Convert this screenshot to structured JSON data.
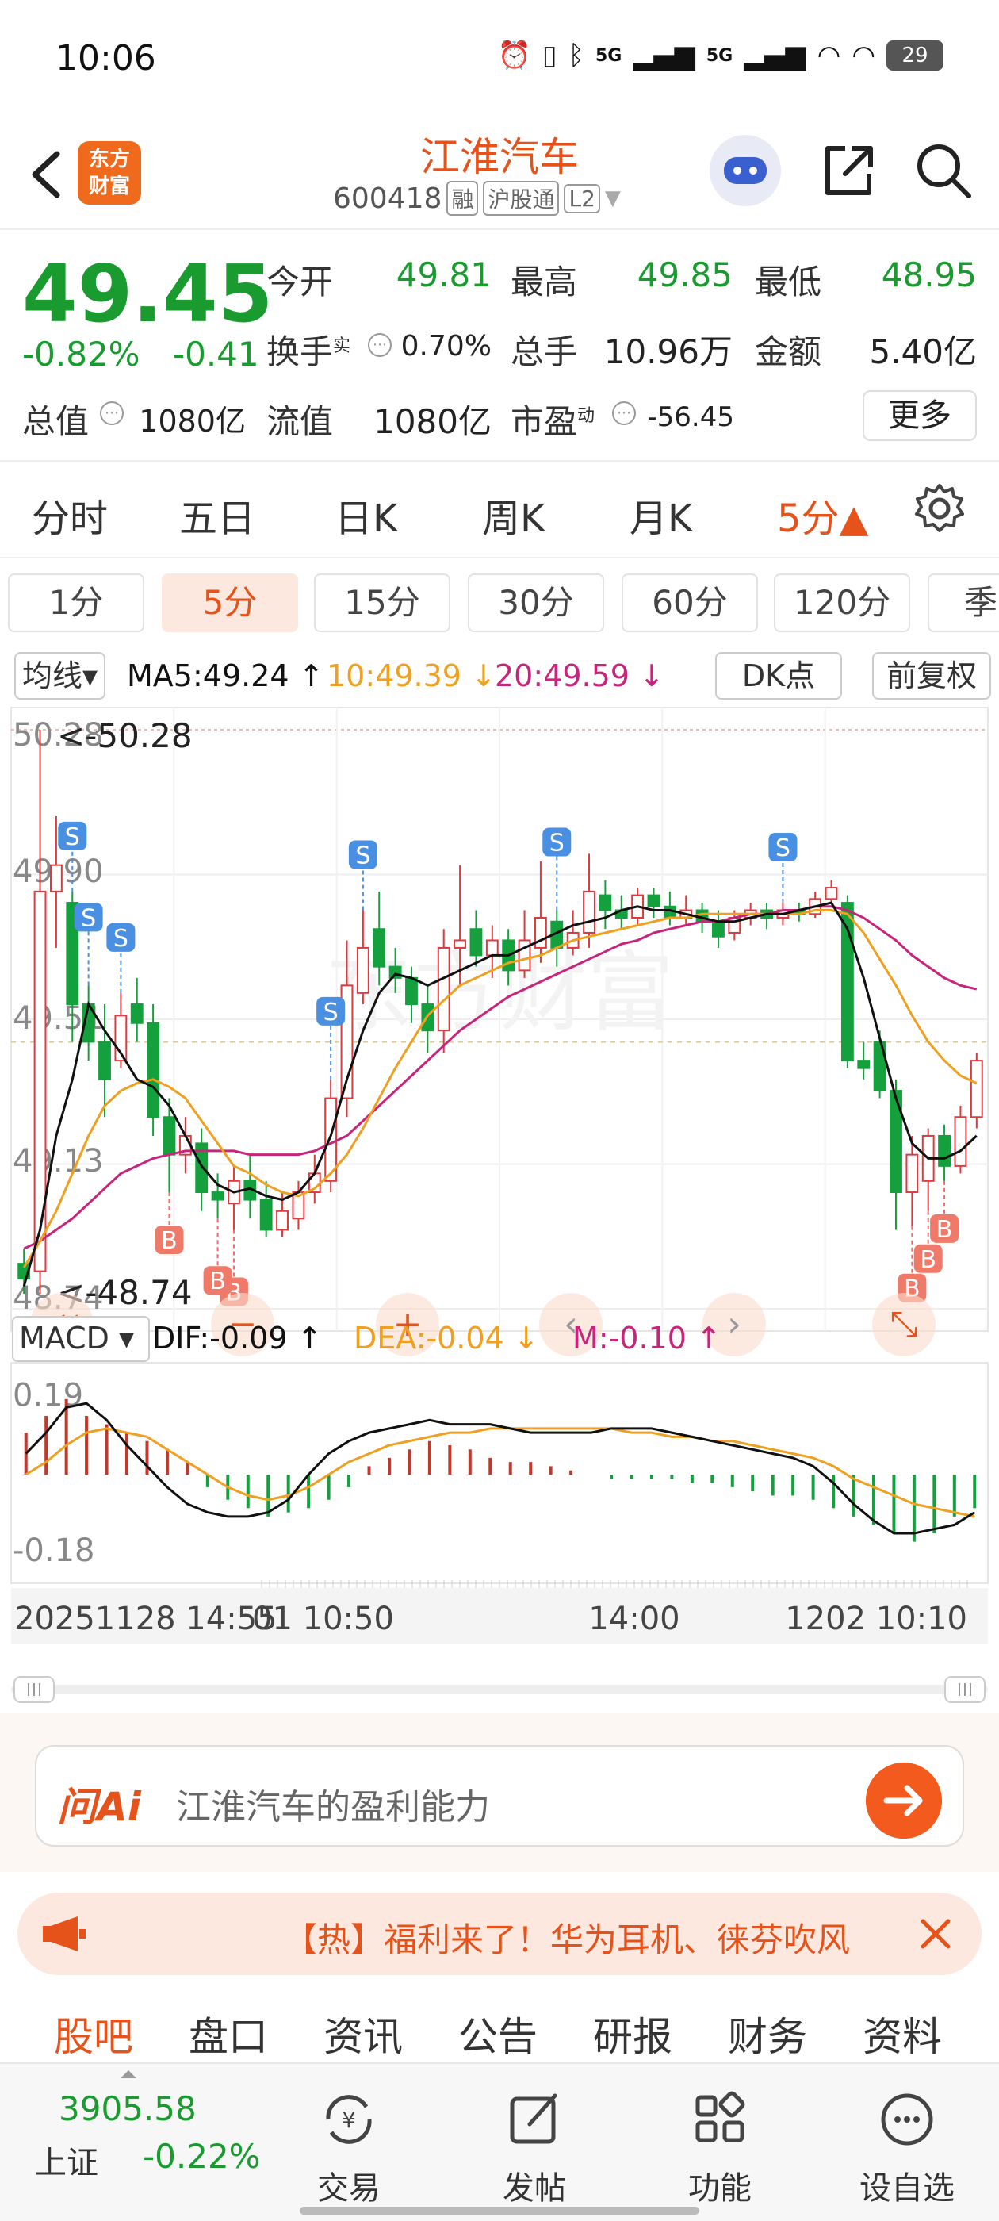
{
  "status": {
    "time": "10:06",
    "signal_label": "5G",
    "battery": "29"
  },
  "header": {
    "stock_name": "江淮汽车",
    "stock_code": "600418",
    "tags": [
      "融",
      "沪股通",
      "L2"
    ],
    "logo_text_line1": "东方",
    "logo_text_line2": "财富"
  },
  "quote": {
    "price": "49.45",
    "change_pct": "-0.82%",
    "change": "-0.41",
    "open_label": "今开",
    "open": "49.81",
    "high_label": "最高",
    "high": "49.85",
    "low_label": "最低",
    "low": "48.95",
    "turnover_label": "换手",
    "turnover_sup": "实",
    "turnover": "0.70%",
    "volume_label": "总手",
    "volume": "10.96万",
    "amount_label": "金额",
    "amount": "5.40亿",
    "mcap_label": "总值",
    "mcap": "1080亿",
    "float_label": "流值",
    "float": "1080亿",
    "pe_label": "市盈",
    "pe_sup": "动",
    "pe": "-56.45",
    "more_label": "更多"
  },
  "period_tabs": [
    "分时",
    "五日",
    "日K",
    "周K",
    "月K",
    "5分▲"
  ],
  "minute_tabs": [
    "1分",
    "5分",
    "15分",
    "30分",
    "60分",
    "120分",
    "季"
  ],
  "ma_row": {
    "select_label": "均线▾",
    "ma5": "MA5:49.24 ↑",
    "ma10": "10:49.39 ↓",
    "ma20": "20:49.59 ↓",
    "dk_label": "DK点",
    "fq_label": "前复权"
  },
  "colors": {
    "up": "#e0393e",
    "down": "#14a03c",
    "ma5": "#111111",
    "ma10": "#f0a020",
    "ma20": "#c8247c",
    "accent": "#e5531b",
    "green_text": "#1a9b2f"
  },
  "chart_data": {
    "type": "candlestick",
    "price_axis_labels": [
      "50.28",
      "49.90",
      "49.51",
      "49.13",
      "48.74"
    ],
    "max_marker": "<-50.28",
    "min_marker": "<-48.74",
    "ylim": [
      48.74,
      50.28
    ],
    "candles": [
      {
        "o": 48.86,
        "c": 48.82,
        "h": 48.9,
        "l": 48.78
      },
      {
        "o": 48.84,
        "c": 49.85,
        "h": 50.28,
        "l": 48.78
      },
      {
        "o": 49.85,
        "c": 49.92,
        "h": 50.05,
        "l": 49.7
      },
      {
        "o": 49.82,
        "c": 49.55,
        "h": 49.85,
        "l": 49.45
      },
      {
        "o": 49.55,
        "c": 49.45,
        "h": 49.6,
        "l": 49.4
      },
      {
        "o": 49.45,
        "c": 49.35,
        "h": 49.55,
        "l": 49.25
      },
      {
        "o": 49.4,
        "c": 49.52,
        "h": 49.58,
        "l": 49.38
      },
      {
        "o": 49.55,
        "c": 49.5,
        "h": 49.62,
        "l": 49.45
      },
      {
        "o": 49.5,
        "c": 49.25,
        "h": 49.55,
        "l": 49.2
      },
      {
        "o": 49.25,
        "c": 49.15,
        "h": 49.3,
        "l": 49.05
      },
      {
        "o": 49.15,
        "c": 49.2,
        "h": 49.25,
        "l": 49.1
      },
      {
        "o": 49.18,
        "c": 49.05,
        "h": 49.22,
        "l": 49.0
      },
      {
        "o": 49.05,
        "c": 49.03,
        "h": 49.1,
        "l": 48.98
      },
      {
        "o": 49.02,
        "c": 49.08,
        "h": 49.12,
        "l": 48.95
      },
      {
        "o": 49.08,
        "c": 49.03,
        "h": 49.15,
        "l": 48.98
      },
      {
        "o": 49.03,
        "c": 48.95,
        "h": 49.08,
        "l": 48.93
      },
      {
        "o": 48.95,
        "c": 49.0,
        "h": 49.05,
        "l": 48.93
      },
      {
        "o": 48.98,
        "c": 49.05,
        "h": 49.08,
        "l": 48.95
      },
      {
        "o": 49.05,
        "c": 49.1,
        "h": 49.15,
        "l": 49.02
      },
      {
        "o": 49.08,
        "c": 49.3,
        "h": 49.35,
        "l": 49.05
      },
      {
        "o": 49.3,
        "c": 49.6,
        "h": 49.72,
        "l": 49.25
      },
      {
        "o": 49.58,
        "c": 49.7,
        "h": 49.8,
        "l": 49.55
      },
      {
        "o": 49.75,
        "c": 49.65,
        "h": 49.85,
        "l": 49.6
      },
      {
        "o": 49.65,
        "c": 49.62,
        "h": 49.7,
        "l": 49.58
      },
      {
        "o": 49.62,
        "c": 49.55,
        "h": 49.65,
        "l": 49.5
      },
      {
        "o": 49.55,
        "c": 49.48,
        "h": 49.6,
        "l": 49.42
      },
      {
        "o": 49.48,
        "c": 49.7,
        "h": 49.75,
        "l": 49.42
      },
      {
        "o": 49.7,
        "c": 49.72,
        "h": 49.92,
        "l": 49.6
      },
      {
        "o": 49.75,
        "c": 49.68,
        "h": 49.8,
        "l": 49.65
      },
      {
        "o": 49.68,
        "c": 49.72,
        "h": 49.76,
        "l": 49.62
      },
      {
        "o": 49.72,
        "c": 49.64,
        "h": 49.75,
        "l": 49.6
      },
      {
        "o": 49.64,
        "c": 49.72,
        "h": 49.8,
        "l": 49.62
      },
      {
        "o": 49.7,
        "c": 49.78,
        "h": 49.93,
        "l": 49.66
      },
      {
        "o": 49.77,
        "c": 49.7,
        "h": 49.8,
        "l": 49.65
      },
      {
        "o": 49.7,
        "c": 49.74,
        "h": 49.8,
        "l": 49.68
      },
      {
        "o": 49.74,
        "c": 49.85,
        "h": 49.95,
        "l": 49.7
      },
      {
        "o": 49.84,
        "c": 49.8,
        "h": 49.88,
        "l": 49.75
      },
      {
        "o": 49.8,
        "c": 49.78,
        "h": 49.84,
        "l": 49.75
      },
      {
        "o": 49.78,
        "c": 49.84,
        "h": 49.86,
        "l": 49.76
      },
      {
        "o": 49.84,
        "c": 49.81,
        "h": 49.86,
        "l": 49.78
      },
      {
        "o": 49.81,
        "c": 49.78,
        "h": 49.85,
        "l": 49.76
      },
      {
        "o": 49.78,
        "c": 49.8,
        "h": 49.84,
        "l": 49.76
      },
      {
        "o": 49.8,
        "c": 49.77,
        "h": 49.82,
        "l": 49.74
      },
      {
        "o": 49.77,
        "c": 49.73,
        "h": 49.8,
        "l": 49.7
      },
      {
        "o": 49.74,
        "c": 49.78,
        "h": 49.8,
        "l": 49.72
      },
      {
        "o": 49.78,
        "c": 49.8,
        "h": 49.82,
        "l": 49.76
      },
      {
        "o": 49.8,
        "c": 49.78,
        "h": 49.82,
        "l": 49.75
      },
      {
        "o": 49.78,
        "c": 49.8,
        "h": 49.82,
        "l": 49.76
      },
      {
        "o": 49.8,
        "c": 49.79,
        "h": 49.82,
        "l": 49.77
      },
      {
        "o": 49.79,
        "c": 49.83,
        "h": 49.85,
        "l": 49.78
      },
      {
        "o": 49.83,
        "c": 49.86,
        "h": 49.88,
        "l": 49.82
      },
      {
        "o": 49.82,
        "c": 49.4,
        "h": 49.84,
        "l": 49.38
      },
      {
        "o": 49.4,
        "c": 49.38,
        "h": 49.45,
        "l": 49.35
      },
      {
        "o": 49.45,
        "c": 49.32,
        "h": 49.48,
        "l": 49.3
      },
      {
        "o": 49.32,
        "c": 49.05,
        "h": 49.35,
        "l": 48.95
      },
      {
        "o": 49.05,
        "c": 49.15,
        "h": 49.2,
        "l": 48.96
      },
      {
        "o": 49.08,
        "c": 49.2,
        "h": 49.22,
        "l": 49.0
      },
      {
        "o": 49.2,
        "c": 49.12,
        "h": 49.23,
        "l": 49.08
      },
      {
        "o": 49.12,
        "c": 49.25,
        "h": 49.28,
        "l": 49.1
      },
      {
        "o": 49.25,
        "c": 49.4,
        "h": 49.42,
        "l": 49.22
      }
    ],
    "ma5": [
      48.8,
      48.95,
      49.2,
      49.35,
      49.55,
      49.48,
      49.42,
      49.35,
      49.33,
      49.28,
      49.2,
      49.12,
      49.07,
      49.05,
      49.06,
      49.04,
      49.03,
      49.05,
      49.1,
      49.2,
      49.35,
      49.48,
      49.58,
      49.63,
      49.62,
      49.6,
      49.62,
      49.64,
      49.66,
      49.68,
      49.68,
      49.7,
      49.72,
      49.74,
      49.76,
      49.77,
      49.78,
      49.8,
      49.81,
      49.8,
      49.8,
      49.79,
      49.78,
      49.77,
      49.77,
      49.78,
      49.79,
      49.79,
      49.8,
      49.81,
      49.82,
      49.75,
      49.62,
      49.46,
      49.3,
      49.18,
      49.14,
      49.14,
      49.16,
      49.2
    ],
    "ma10": [
      48.85,
      48.92,
      49.0,
      49.1,
      49.2,
      49.28,
      49.32,
      49.34,
      49.35,
      49.33,
      49.3,
      49.24,
      49.18,
      49.12,
      49.1,
      49.07,
      49.05,
      49.04,
      49.06,
      49.1,
      49.15,
      49.22,
      49.3,
      49.38,
      49.45,
      49.52,
      49.56,
      49.6,
      49.62,
      49.64,
      49.66,
      49.67,
      49.68,
      49.7,
      49.72,
      49.73,
      49.74,
      49.75,
      49.76,
      49.77,
      49.78,
      49.78,
      49.79,
      49.79,
      49.79,
      49.79,
      49.79,
      49.79,
      49.79,
      49.8,
      49.8,
      49.79,
      49.74,
      49.67,
      49.6,
      49.52,
      49.45,
      49.4,
      49.36,
      49.34
    ],
    "ma20": [
      48.9,
      48.92,
      48.95,
      48.98,
      49.02,
      49.06,
      49.1,
      49.12,
      49.14,
      49.15,
      49.16,
      49.16,
      49.16,
      49.16,
      49.15,
      49.15,
      49.15,
      49.15,
      49.16,
      49.18,
      49.2,
      49.24,
      49.28,
      49.32,
      49.36,
      49.4,
      49.44,
      49.48,
      49.51,
      49.54,
      49.57,
      49.59,
      49.61,
      49.63,
      49.65,
      49.67,
      49.69,
      49.71,
      49.72,
      49.74,
      49.75,
      49.76,
      49.77,
      49.77,
      49.78,
      49.79,
      49.79,
      49.8,
      49.8,
      49.81,
      49.81,
      49.8,
      49.78,
      49.75,
      49.72,
      49.68,
      49.65,
      49.62,
      49.6,
      49.59
    ],
    "signals": [
      {
        "i": 3,
        "t": "S"
      },
      {
        "i": 4,
        "t": "S"
      },
      {
        "i": 6,
        "t": "S"
      },
      {
        "i": 19,
        "t": "S"
      },
      {
        "i": 21,
        "t": "S"
      },
      {
        "i": 33,
        "t": "S"
      },
      {
        "i": 47,
        "t": "S"
      },
      {
        "i": 13,
        "t": "B"
      },
      {
        "i": 9,
        "t": "B"
      },
      {
        "i": 12,
        "t": "B"
      },
      {
        "i": 56,
        "t": "B"
      },
      {
        "i": 55,
        "t": "B"
      },
      {
        "i": 57,
        "t": "B"
      }
    ],
    "macd": {
      "axis_labels": [
        "0.19",
        "-0.18"
      ],
      "ylim": [
        -0.21,
        0.21
      ],
      "dif": [
        0.05,
        0.1,
        0.16,
        0.17,
        0.13,
        0.07,
        0.02,
        -0.03,
        -0.07,
        -0.09,
        -0.1,
        -0.1,
        -0.09,
        -0.06,
        0.0,
        0.05,
        0.08,
        0.1,
        0.11,
        0.12,
        0.13,
        0.12,
        0.12,
        0.12,
        0.11,
        0.1,
        0.1,
        0.1,
        0.1,
        0.11,
        0.11,
        0.11,
        0.1,
        0.09,
        0.08,
        0.07,
        0.06,
        0.05,
        0.04,
        0.02,
        -0.02,
        -0.07,
        -0.11,
        -0.14,
        -0.14,
        -0.13,
        -0.12,
        -0.09
      ],
      "dea": [
        0.0,
        0.03,
        0.07,
        0.1,
        0.11,
        0.1,
        0.09,
        0.06,
        0.03,
        0.0,
        -0.03,
        -0.05,
        -0.06,
        -0.05,
        -0.03,
        0.0,
        0.03,
        0.05,
        0.07,
        0.08,
        0.09,
        0.1,
        0.1,
        0.11,
        0.11,
        0.11,
        0.11,
        0.11,
        0.11,
        0.11,
        0.1,
        0.1,
        0.09,
        0.09,
        0.08,
        0.08,
        0.07,
        0.06,
        0.05,
        0.04,
        0.02,
        -0.01,
        -0.03,
        -0.05,
        -0.07,
        -0.08,
        -0.09,
        -0.1
      ],
      "hist": [
        0.1,
        0.14,
        0.18,
        0.14,
        0.12,
        0.1,
        0.08,
        0.06,
        0.03,
        -0.03,
        -0.06,
        -0.08,
        -0.1,
        -0.09,
        -0.08,
        -0.06,
        -0.03,
        0.02,
        0.04,
        0.06,
        0.08,
        0.07,
        0.06,
        0.04,
        0.03,
        0.03,
        0.02,
        0.01,
        0.0,
        -0.01,
        -0.01,
        -0.01,
        -0.01,
        -0.02,
        -0.02,
        -0.03,
        -0.04,
        -0.05,
        -0.05,
        -0.06,
        -0.08,
        -0.1,
        -0.12,
        -0.14,
        -0.16,
        -0.14,
        -0.1,
        -0.08
      ],
      "label": "MACD",
      "dif_label": "DIF:-0.09 ↑",
      "dea_label": "DEA:-0.04 ↓",
      "m_label": "M:-0.10 ↑"
    },
    "time_labels": [
      "20251128 14:55",
      "01 10:50",
      "14:00",
      "1202 10:10"
    ]
  },
  "ai": {
    "logo": "问Ai",
    "prompt": "江淮汽车的盈利能力"
  },
  "notice": {
    "text": "【热】福利来了！华为耳机、徕芬吹风"
  },
  "sub_tabs": [
    "股吧",
    "盘口",
    "资讯",
    "公告",
    "研报",
    "财务",
    "资料"
  ],
  "bottom_nav": {
    "index_value": "3905.58",
    "index_name": "上证",
    "index_change": "-0.22%",
    "items": [
      "交易",
      "发帖",
      "功能",
      "设自选"
    ]
  }
}
